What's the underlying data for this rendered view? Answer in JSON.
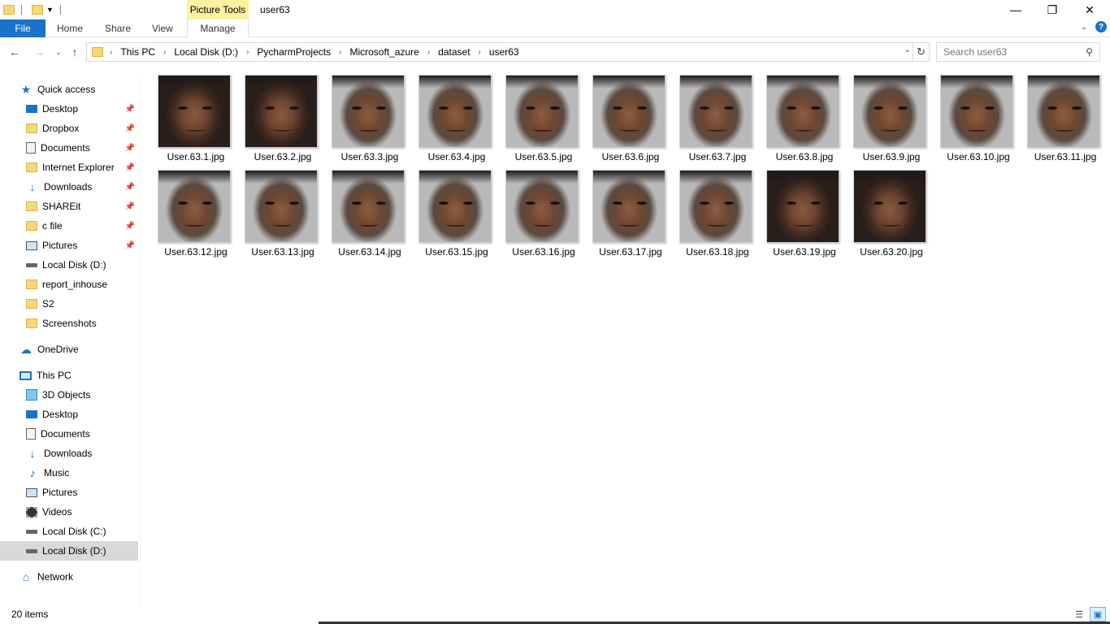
{
  "window": {
    "title": "user63",
    "context_tab_group": "Picture Tools",
    "minimize_icon": "minimize-icon",
    "maximize_icon": "restore-icon",
    "close_icon": "close-icon"
  },
  "ribbon": {
    "tabs": [
      "File",
      "Home",
      "Share",
      "View",
      "Manage"
    ],
    "accent": "#1a73c8",
    "context_color": "#fbf19e"
  },
  "address": {
    "crumbs": [
      "This PC",
      "Local Disk (D:)",
      "PycharmProjects",
      "Microsoft_azure",
      "dataset",
      "user63"
    ]
  },
  "search": {
    "placeholder": "Search user63"
  },
  "sidebar": {
    "quick_access": {
      "label": "Quick access",
      "items": [
        {
          "label": "Desktop",
          "icon": "desktop-icon",
          "pinned": true
        },
        {
          "label": "Dropbox",
          "icon": "folder-icon",
          "pinned": true
        },
        {
          "label": "Documents",
          "icon": "documents-icon",
          "pinned": true
        },
        {
          "label": "Internet Explorer",
          "icon": "folder-icon",
          "pinned": true
        },
        {
          "label": "Downloads",
          "icon": "downloads-icon",
          "pinned": true
        },
        {
          "label": "SHAREit",
          "icon": "folder-icon",
          "pinned": true
        },
        {
          "label": "c file",
          "icon": "folder-icon",
          "pinned": true
        },
        {
          "label": "Pictures",
          "icon": "pictures-icon",
          "pinned": true
        },
        {
          "label": "Local Disk (D:)",
          "icon": "disk-icon",
          "pinned": false
        },
        {
          "label": "report_inhouse",
          "icon": "folder-icon",
          "pinned": false
        },
        {
          "label": "S2",
          "icon": "folder-icon",
          "pinned": false
        },
        {
          "label": "Screenshots",
          "icon": "folder-icon",
          "pinned": false
        }
      ]
    },
    "onedrive": {
      "label": "OneDrive"
    },
    "this_pc": {
      "label": "This PC",
      "items": [
        {
          "label": "3D Objects",
          "icon": "3d-objects-icon"
        },
        {
          "label": "Desktop",
          "icon": "desktop-icon"
        },
        {
          "label": "Documents",
          "icon": "documents-icon"
        },
        {
          "label": "Downloads",
          "icon": "downloads-icon"
        },
        {
          "label": "Music",
          "icon": "music-icon"
        },
        {
          "label": "Pictures",
          "icon": "pictures-icon"
        },
        {
          "label": "Videos",
          "icon": "videos-icon"
        },
        {
          "label": "Local Disk (C:)",
          "icon": "disk-icon"
        },
        {
          "label": "Local Disk (D:)",
          "icon": "disk-icon",
          "selected": true
        }
      ]
    },
    "network": {
      "label": "Network"
    }
  },
  "files": [
    "User.63.1.jpg",
    "User.63.2.jpg",
    "User.63.3.jpg",
    "User.63.4.jpg",
    "User.63.5.jpg",
    "User.63.6.jpg",
    "User.63.7.jpg",
    "User.63.8.jpg",
    "User.63.9.jpg",
    "User.63.10.jpg",
    "User.63.11.jpg",
    "User.63.12.jpg",
    "User.63.13.jpg",
    "User.63.14.jpg",
    "User.63.15.jpg",
    "User.63.16.jpg",
    "User.63.17.jpg",
    "User.63.18.jpg",
    "User.63.19.jpg",
    "User.63.20.jpg"
  ],
  "status": {
    "item_count": "20 items"
  }
}
